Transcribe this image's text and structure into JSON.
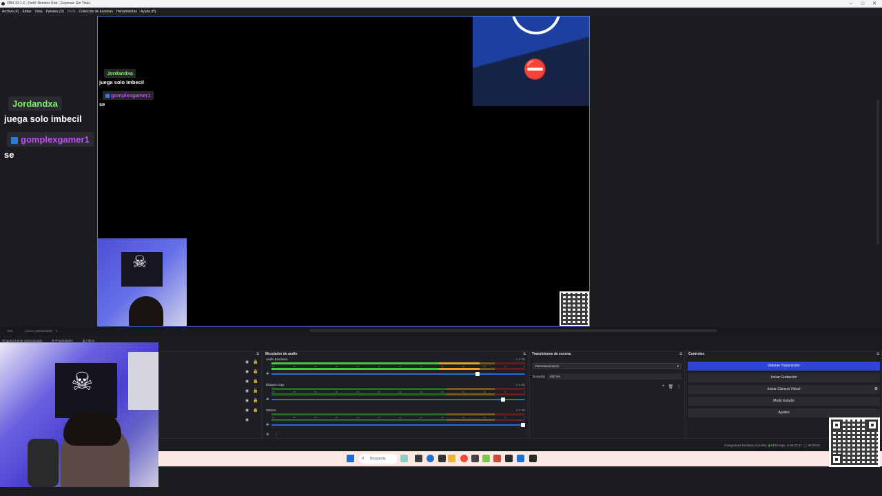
{
  "window": {
    "title": "OBS 32.1.4 - Perfil: Directos Kick - Escenas: Sin Título",
    "controls": [
      "–",
      "□",
      "✕"
    ]
  },
  "menu": [
    "Archivo (F)",
    "Editar",
    "Vista",
    "Paneles (D)",
    "Perfil",
    "Colección de Escenas",
    "Herramientas",
    "Ayuda (H)"
  ],
  "preview": {
    "chat": [
      {
        "user": "Jordandxa",
        "message": "juega solo imbecil",
        "color": "#7ef55f"
      },
      {
        "user": "gomplexgamer1",
        "message": "se",
        "color": "#c04ef2"
      }
    ]
  },
  "strip": {
    "zoom": "10%",
    "canvas": "Lienzo (1920x1080)",
    "sources_toolbar": [
      "Ninguna fuente seleccionada",
      "Propiedades",
      "Filtros"
    ]
  },
  "sources": {
    "rows": [
      {
        "visible": true,
        "locked": true
      },
      {
        "visible": true,
        "locked": true
      },
      {
        "visible": true,
        "locked": true
      },
      {
        "visible": true,
        "locked": true
      },
      {
        "visible": true,
        "locked": true
      },
      {
        "visible": true,
        "locked": true
      },
      {
        "visible": true,
        "locked": false
      }
    ]
  },
  "mixer": {
    "title": "Mezclador de audio",
    "channels": [
      {
        "name": "Audio Escritorio",
        "db": "-1.3 dB",
        "level": 0.82,
        "fader": 0.82
      },
      {
        "name": "bloques copy",
        "db": "-1.3 dB",
        "level": 0.0,
        "fader": 0.92
      },
      {
        "name": "Música",
        "db": "0.0 dB",
        "level": 0.0,
        "fader": 1.0
      }
    ],
    "ticks": [
      "-60",
      "-55",
      "-50",
      "-45",
      "-40",
      "-35",
      "-30",
      "-25",
      "-20",
      "-15",
      "-10",
      "-5",
      "0"
    ]
  },
  "transitions": {
    "title": "Transiciones de escena",
    "selected": "Desvanecimiento",
    "duration_label": "Duración",
    "duration_value": "300 ms"
  },
  "controls": {
    "title": "Controles",
    "buttons": [
      {
        "label": "Detener Transmisión",
        "primary": true
      },
      {
        "label": "Iniciar Grabación",
        "primary": false
      },
      {
        "label": "Iniciar Cámara Virtual",
        "primary": false
      },
      {
        "label": "Modo Estudio",
        "primary": false
      },
      {
        "label": "Ajustes",
        "primary": false
      }
    ]
  },
  "status": {
    "frames": "Fotogramas Perdidos 0 (0.0%)",
    "bitrate": "8180 kbps",
    "time": "00:20:37",
    "cpu": "00:00:00"
  },
  "taskbar": {
    "search": "Búsqueda"
  },
  "colors": {
    "accent": "#2e44d4",
    "preview_border": "#3c7de8",
    "meter_green": "#39d32f",
    "meter_yellow": "#f0a020",
    "meter_red": "#e82a2a"
  }
}
